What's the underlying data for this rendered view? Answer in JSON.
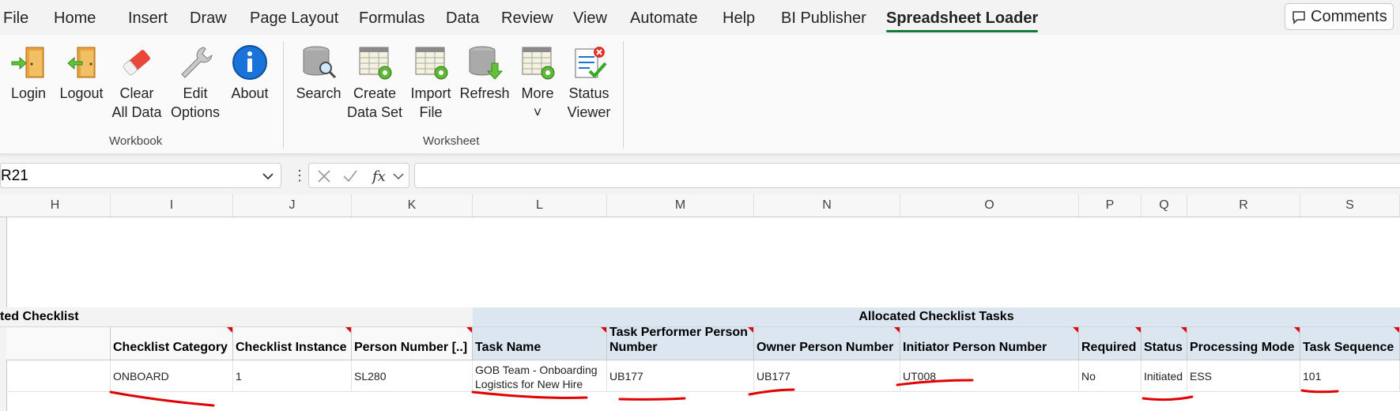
{
  "menu": {
    "items": [
      "File",
      "Home",
      "Insert",
      "Draw",
      "Page Layout",
      "Formulas",
      "Data",
      "Review",
      "View",
      "Automate",
      "Help",
      "BI Publisher",
      "Spreadsheet Loader"
    ],
    "active": "Spreadsheet Loader",
    "comments_label": "Comments"
  },
  "ribbon": {
    "workbook": {
      "label": "Workbook",
      "buttons": [
        {
          "line1": "Login",
          "line2": "",
          "icon": "login-door-icon"
        },
        {
          "line1": "Logout",
          "line2": "",
          "icon": "logout-door-icon"
        },
        {
          "line1": "Clear",
          "line2": "All Data",
          "icon": "eraser-icon"
        },
        {
          "line1": "Edit",
          "line2": "Options",
          "icon": "wrench-icon"
        },
        {
          "line1": "About",
          "line2": "",
          "icon": "info-icon"
        }
      ]
    },
    "worksheet": {
      "label": "Worksheet",
      "buttons": [
        {
          "line1": "Search",
          "line2": "",
          "icon": "database-search-icon"
        },
        {
          "line1": "Create",
          "line2": "Data Set",
          "icon": "sheet-gear-icon"
        },
        {
          "line1": "Import",
          "line2": "File",
          "icon": "sheet-import-icon"
        },
        {
          "line1": "Refresh",
          "line2": "",
          "icon": "database-refresh-icon"
        },
        {
          "line1": "More",
          "line2": "˅",
          "icon": "sheet-more-icon"
        },
        {
          "line1": "Status",
          "line2": "Viewer",
          "icon": "status-viewer-icon"
        }
      ]
    }
  },
  "formula_bar": {
    "name_box": "R21",
    "formula": ""
  },
  "columns": [
    "H",
    "I",
    "J",
    "K",
    "L",
    "M",
    "N",
    "O",
    "P",
    "Q",
    "R",
    "S"
  ],
  "sheet": {
    "band_left": "ted Checklist",
    "band_right": "Allocated Checklist Tasks",
    "headers": [
      "",
      "Checklist Category",
      "Checklist Instance",
      "Person Number [..]",
      "Task Name",
      "Task Performer Person Number",
      "Owner Person Number",
      "Initiator Person Number",
      "Required",
      "Status",
      "Processing Mode",
      "Task Sequence"
    ],
    "row": [
      "",
      "ONBOARD",
      "1",
      "SL280",
      "GOB Team - Onboarding Logistics for New Hire",
      "UB177",
      "UB177",
      "UT008",
      "No",
      "Initiated",
      "ESS",
      "101"
    ]
  },
  "colors": {
    "accent_green": "#137a3a",
    "annotation_red": "#e00000",
    "header_blue": "#dce6f1"
  }
}
